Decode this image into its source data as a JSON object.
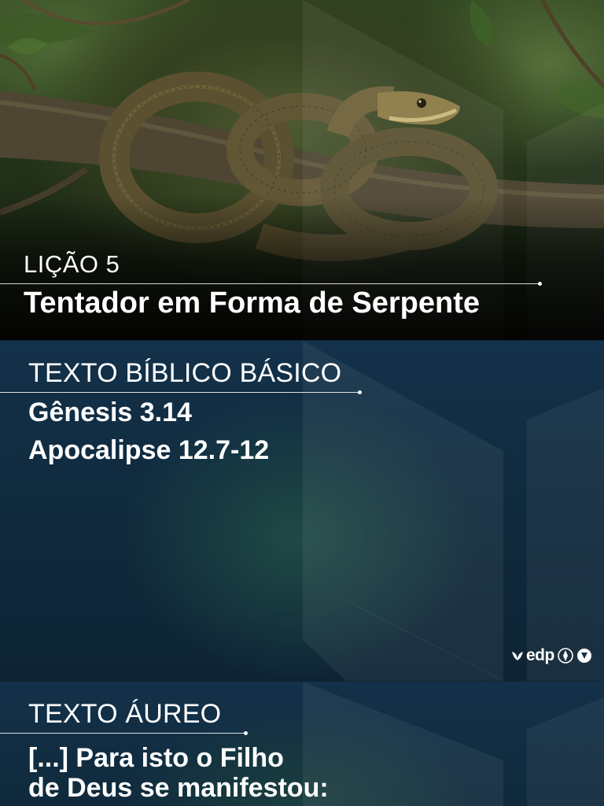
{
  "hero": {
    "lesson_label": "LIÇÃO 5",
    "title": "Tentador em Forma de Serpente"
  },
  "basic_text": {
    "heading": "TEXTO BÍBLICO BÁSICO",
    "references": [
      "Gênesis 3.14",
      "Apocalipse 12.7-12"
    ]
  },
  "golden_text": {
    "heading": "TEXTO ÁUREO",
    "lines": [
      "[...] Para isto o Filho",
      "de Deus se manifestou:"
    ]
  },
  "logo": {
    "wordmark": "edp"
  },
  "colors": {
    "background_navy": "#102a3c",
    "text": "#ffffff",
    "forest_green": "#2f4420"
  },
  "icons": [
    "snake-illustration",
    "leaf-icon",
    "compass-icon",
    "shield-icon"
  ]
}
